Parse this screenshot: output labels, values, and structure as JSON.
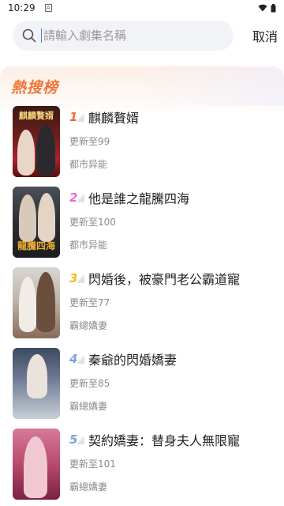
{
  "status_bar": {
    "time": "10:29",
    "notification_glyph": "A"
  },
  "search": {
    "placeholder": "請輸入劇集名稱",
    "cancel_label": "取消"
  },
  "hot_section": {
    "title": "熱搜榜",
    "items": [
      {
        "rank": "1",
        "rank_color": "#f26b3a",
        "name": "麒麟贅婿",
        "update": "更新至99",
        "genre": "都市异能",
        "cover_text": "麒麟贅婿"
      },
      {
        "rank": "2",
        "rank_color": "#e66ad6",
        "name": "他是誰之龍騰四海",
        "update": "更新至100",
        "genre": "都市异能",
        "cover_text": "龍騰四海"
      },
      {
        "rank": "3",
        "rank_color": "#f2b820",
        "name": "閃婚後，被豪門老公霸道寵",
        "update": "更新至77",
        "genre": "霸總嬌妻",
        "cover_text": ""
      },
      {
        "rank": "4",
        "rank_color": "#7fa3d8",
        "name": "秦爺的閃婚嬌妻",
        "update": "更新至85",
        "genre": "霸總嬌妻",
        "cover_text": ""
      },
      {
        "rank": "5",
        "rank_color": "#7fa3d8",
        "name": "契約嬌妻：替身夫人無限寵",
        "update": "更新至101",
        "genre": "霸總嬌妻",
        "cover_text": ""
      }
    ]
  }
}
